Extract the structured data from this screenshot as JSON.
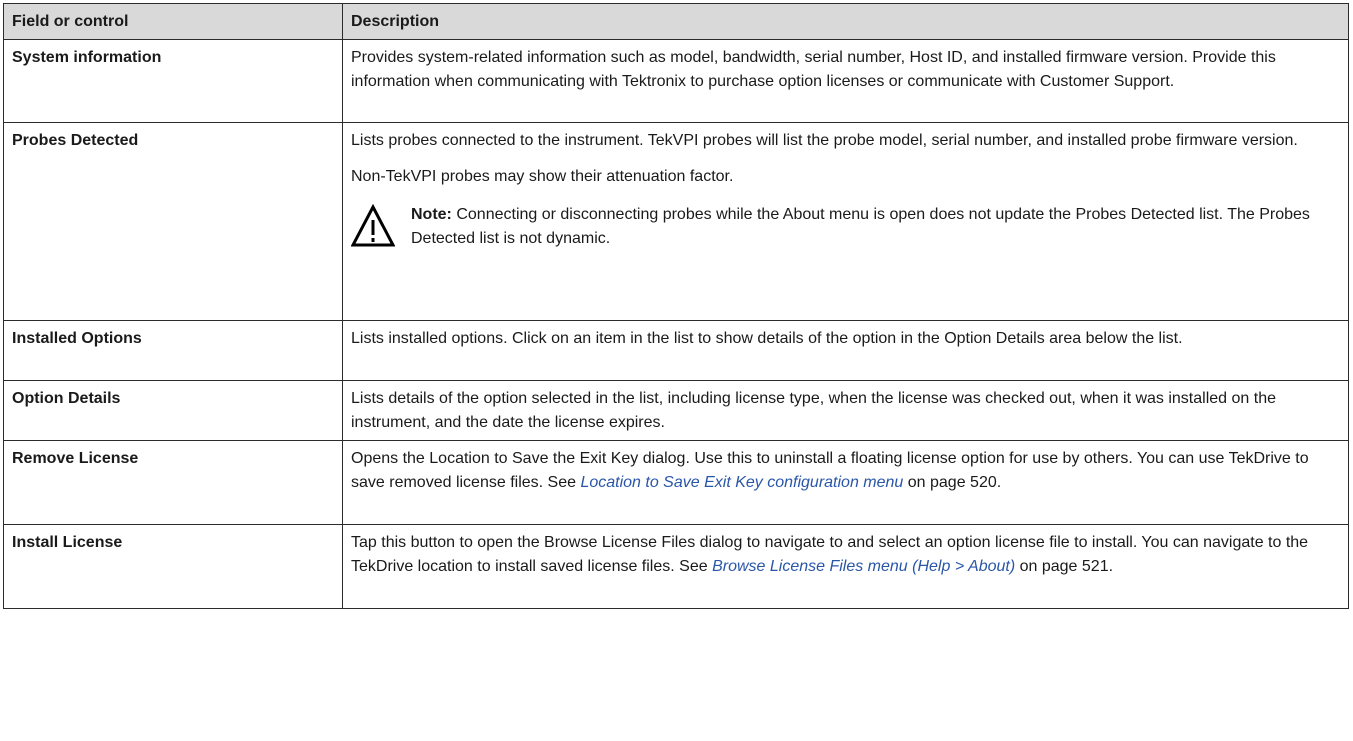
{
  "table": {
    "headers": [
      "Field or control",
      "Description"
    ],
    "rows": [
      {
        "field": "System information",
        "desc": "Provides system-related information such as model, bandwidth, serial number, Host ID, and installed firmware version. Provide this information when communicating with Tektronix to purchase option licenses or communicate with Customer Support."
      },
      {
        "field": "Probes Detected",
        "desc": "Lists probes connected to the instrument. TekVPI probes will list the probe model, serial number, and installed probe firmware version.",
        "desc2": "Non-TekVPI probes may show their attenuation factor.",
        "note_label": "Note:",
        "note_text": "Connecting or disconnecting probes while the About menu is open does not update the Probes Detected list. The Probes Detected list is not dynamic.",
        "note_icon": "warning-triangle-icon"
      },
      {
        "field": "Installed Options",
        "desc": "Lists installed options. Click on an item in the list to show details of the option in the Option Details area below the list."
      },
      {
        "field": "Option Details",
        "desc": "Lists details of the option selected in the list, including license type, when the license was checked out, when it was installed on the instrument, and the date the license expires."
      },
      {
        "field": "Remove License",
        "desc_pre": "Opens the Location to Save the Exit Key dialog. Use this to uninstall a floating license option for use by others. You can use TekDrive to save removed license files. See ",
        "link": "Location to Save Exit Key configuration menu",
        "desc_post": " on page 520."
      },
      {
        "field": "Install License",
        "desc_pre": "Tap this button to open the Browse License Files dialog to navigate to and select an option license file to install. You can navigate to the TekDrive location to install saved license files. See ",
        "link": "Browse License Files menu (Help > About)",
        "desc_post": " on page 521."
      }
    ]
  },
  "colors": {
    "header_bg": "#d9d9d9",
    "border": "#2b2b2b",
    "link": "#2a56a8"
  }
}
